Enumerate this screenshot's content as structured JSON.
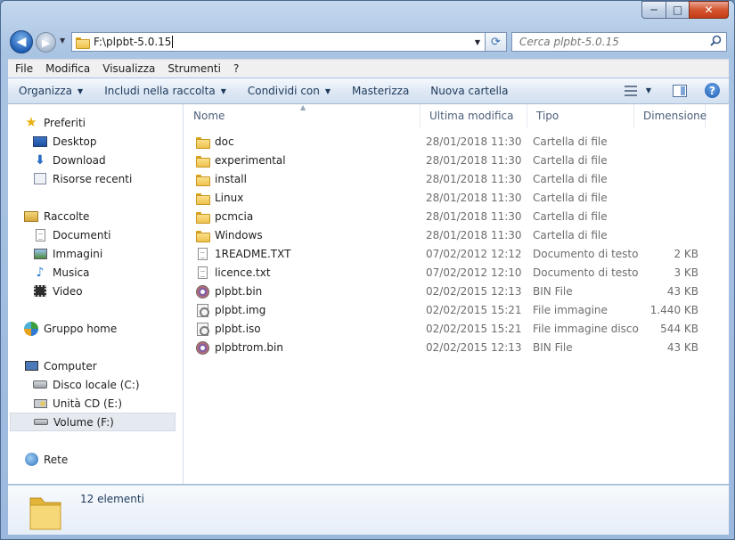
{
  "window": {
    "minimize": "─",
    "maximize": "□",
    "close": "✕"
  },
  "address": {
    "path": "F:\\plpbt-5.0.15"
  },
  "search": {
    "placeholder": "Cerca plpbt-5.0.15"
  },
  "menu": [
    "File",
    "Modifica",
    "Visualizza",
    "Strumenti",
    "?"
  ],
  "commands": [
    {
      "label": "Organizza",
      "dropdown": true
    },
    {
      "label": "Includi nella raccolta",
      "dropdown": true
    },
    {
      "label": "Condividi con",
      "dropdown": true
    },
    {
      "label": "Masterizza",
      "dropdown": false
    },
    {
      "label": "Nuova cartella",
      "dropdown": false
    }
  ],
  "nav": {
    "favorites": {
      "label": "Preferiti",
      "items": [
        "Desktop",
        "Download",
        "Risorse recenti"
      ]
    },
    "libraries": {
      "label": "Raccolte",
      "items": [
        "Documenti",
        "Immagini",
        "Musica",
        "Video"
      ]
    },
    "homegroup": {
      "label": "Gruppo home"
    },
    "computer": {
      "label": "Computer",
      "items": [
        "Disco locale (C:)",
        "Unità CD (E:)",
        "Volume (F:)"
      ],
      "selected": "Volume (F:)"
    },
    "network": {
      "label": "Rete"
    }
  },
  "columns": {
    "name": "Nome",
    "modified": "Ultima modifica",
    "type": "Tipo",
    "size": "Dimensione"
  },
  "files": [
    {
      "name": "doc",
      "modified": "28/01/2018 11:30",
      "type": "Cartella di file",
      "size": "",
      "icon": "folder-icon"
    },
    {
      "name": "experimental",
      "modified": "28/01/2018 11:30",
      "type": "Cartella di file",
      "size": "",
      "icon": "folder-icon"
    },
    {
      "name": "install",
      "modified": "28/01/2018 11:30",
      "type": "Cartella di file",
      "size": "",
      "icon": "folder-icon"
    },
    {
      "name": "Linux",
      "modified": "28/01/2018 11:30",
      "type": "Cartella di file",
      "size": "",
      "icon": "folder-icon"
    },
    {
      "name": "pcmcia",
      "modified": "28/01/2018 11:30",
      "type": "Cartella di file",
      "size": "",
      "icon": "folder-icon"
    },
    {
      "name": "Windows",
      "modified": "28/01/2018 11:30",
      "type": "Cartella di file",
      "size": "",
      "icon": "folder-icon"
    },
    {
      "name": "1README.TXT",
      "modified": "07/02/2012 12:12",
      "type": "Documento di testo",
      "size": "2 KB",
      "icon": "text-file-icon"
    },
    {
      "name": "licence.txt",
      "modified": "07/02/2012 12:10",
      "type": "Documento di testo",
      "size": "3 KB",
      "icon": "text-file-icon"
    },
    {
      "name": "plpbt.bin",
      "modified": "02/02/2015 12:13",
      "type": "BIN File",
      "size": "43 KB",
      "icon": "bin-file-icon"
    },
    {
      "name": "plpbt.img",
      "modified": "02/02/2015 15:21",
      "type": "File immagine",
      "size": "1.440 KB",
      "icon": "image-file-icon"
    },
    {
      "name": "plpbt.iso",
      "modified": "02/02/2015 15:21",
      "type": "File immagine disco",
      "size": "544 KB",
      "icon": "disc-image-icon"
    },
    {
      "name": "plpbtrom.bin",
      "modified": "02/02/2015 12:13",
      "type": "BIN File",
      "size": "43 KB",
      "icon": "bin-file-icon"
    }
  ],
  "details": {
    "count": "12 elementi"
  }
}
